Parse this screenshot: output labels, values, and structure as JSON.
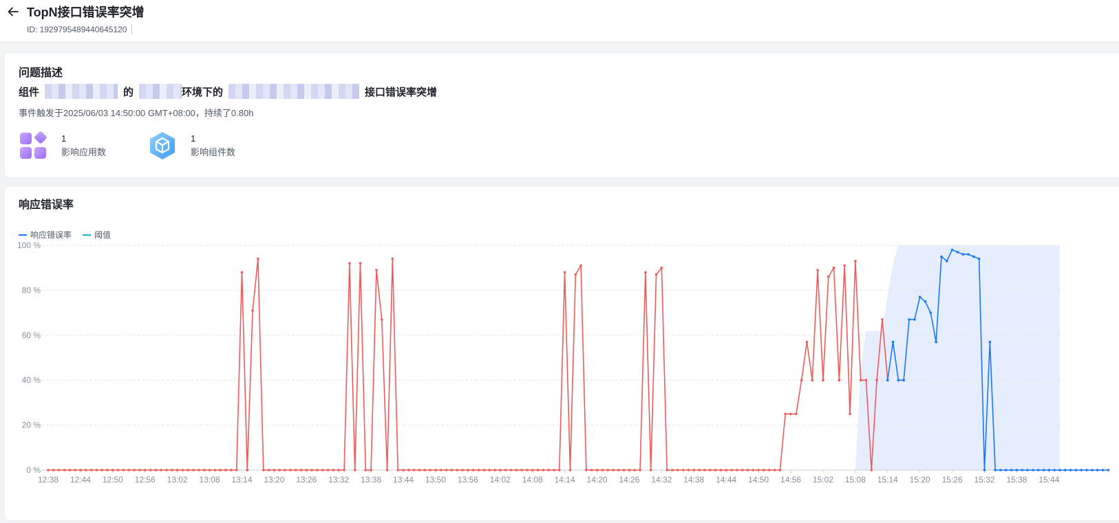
{
  "header": {
    "title": "TopN接口错误率突增",
    "id_label": "ID: 1929795489440645120"
  },
  "problem": {
    "section_title": "问题描述",
    "prefix": "组件",
    "joiner_1": "的",
    "joiner_2": "环境下的",
    "suffix": "接口错误率突增",
    "trigger_text": "事件触发于2025/06/03 14:50:00 GMT+08:00，持续了0.80h",
    "stats": [
      {
        "value": "1",
        "label": "影响应用数",
        "icon": "apps-grid-icon"
      },
      {
        "value": "1",
        "label": "影响组件数",
        "icon": "component-cube-icon"
      }
    ]
  },
  "chart_section": {
    "title": "响应错误率",
    "legend": [
      {
        "name": "响应错误率",
        "color": "#1677ff"
      },
      {
        "name": "阈值",
        "color": "#14b3c7"
      }
    ]
  },
  "colors": {
    "normal_line": "#1677ff",
    "alarm_line": "#ee5a5a",
    "threshold_fill": "#e6eefd"
  },
  "chart_data": {
    "type": "line",
    "title": "响应错误率",
    "ylim": [
      0,
      100
    ],
    "y_ticks": [
      "0 %",
      "20 %",
      "40 %",
      "60 %",
      "80 %",
      "100 %"
    ],
    "x_ticks": [
      "12:38",
      "12:44",
      "12:50",
      "12:56",
      "13:02",
      "13:08",
      "13:14",
      "13:20",
      "13:26",
      "13:32",
      "13:38",
      "13:44",
      "13:50",
      "13:56",
      "14:02",
      "14:08",
      "14:14",
      "14:20",
      "14:26",
      "14:32",
      "14:38",
      "14:44",
      "14:50",
      "14:56",
      "15:02",
      "15:08",
      "15:14",
      "15:20",
      "15:26",
      "15:32",
      "15:38",
      "15:44"
    ],
    "grid": true,
    "x_start": "12:38",
    "x_end": "15:46",
    "x_step_minutes": 1,
    "series": [
      {
        "name": "响应错误率",
        "values": [
          0,
          0,
          0,
          0,
          0,
          0,
          0,
          0,
          0,
          0,
          0,
          0,
          0,
          0,
          0,
          0,
          0,
          0,
          0,
          0,
          0,
          0,
          0,
          0,
          0,
          0,
          0,
          0,
          0,
          0,
          0,
          0,
          0,
          0,
          0,
          0,
          88,
          0,
          71,
          94,
          0,
          0,
          0,
          0,
          0,
          0,
          0,
          0,
          0,
          0,
          0,
          0,
          0,
          0,
          0,
          0,
          92,
          0,
          92,
          0,
          0,
          89,
          67,
          0,
          94,
          0,
          0,
          0,
          0,
          0,
          0,
          0,
          0,
          0,
          0,
          0,
          0,
          0,
          0,
          0,
          0,
          0,
          0,
          0,
          0,
          0,
          0,
          0,
          0,
          0,
          0,
          0,
          0,
          0,
          0,
          0,
          88,
          0,
          87,
          91,
          0,
          0,
          0,
          0,
          0,
          0,
          0,
          0,
          0,
          0,
          0,
          88,
          0,
          87,
          90,
          0,
          0,
          0,
          0,
          0,
          0,
          0,
          0,
          0,
          0,
          0,
          0,
          0,
          0,
          0,
          0,
          0,
          0,
          0,
          0,
          0,
          0,
          25,
          25,
          25,
          40,
          57,
          40,
          89,
          40,
          86,
          90,
          40,
          91,
          25,
          93,
          40,
          40,
          0,
          40,
          67,
          40,
          57,
          40,
          40,
          67,
          67,
          77,
          75,
          70,
          57,
          95,
          93,
          98,
          97,
          96,
          96,
          95,
          94,
          0,
          57,
          0,
          0,
          0,
          0,
          0,
          0,
          0,
          0,
          0,
          0,
          0,
          0,
          0,
          0,
          0,
          0,
          0,
          0,
          0,
          0,
          0,
          0
        ]
      }
    ],
    "alarm_segments": [
      [
        "12:38",
        "15:14"
      ]
    ],
    "threshold_band": [
      {
        "time": "15:08",
        "upper": 0
      },
      {
        "time": "15:09",
        "upper": 45
      },
      {
        "time": "15:10",
        "upper": 62
      },
      {
        "time": "15:11",
        "upper": 62
      },
      {
        "time": "15:12",
        "upper": 62
      },
      {
        "time": "15:13",
        "upper": 62
      },
      {
        "time": "15:14",
        "upper": 78
      },
      {
        "time": "15:15",
        "upper": 92
      },
      {
        "time": "15:16",
        "upper": 100
      },
      {
        "time": "15:46",
        "upper": 100
      }
    ]
  }
}
